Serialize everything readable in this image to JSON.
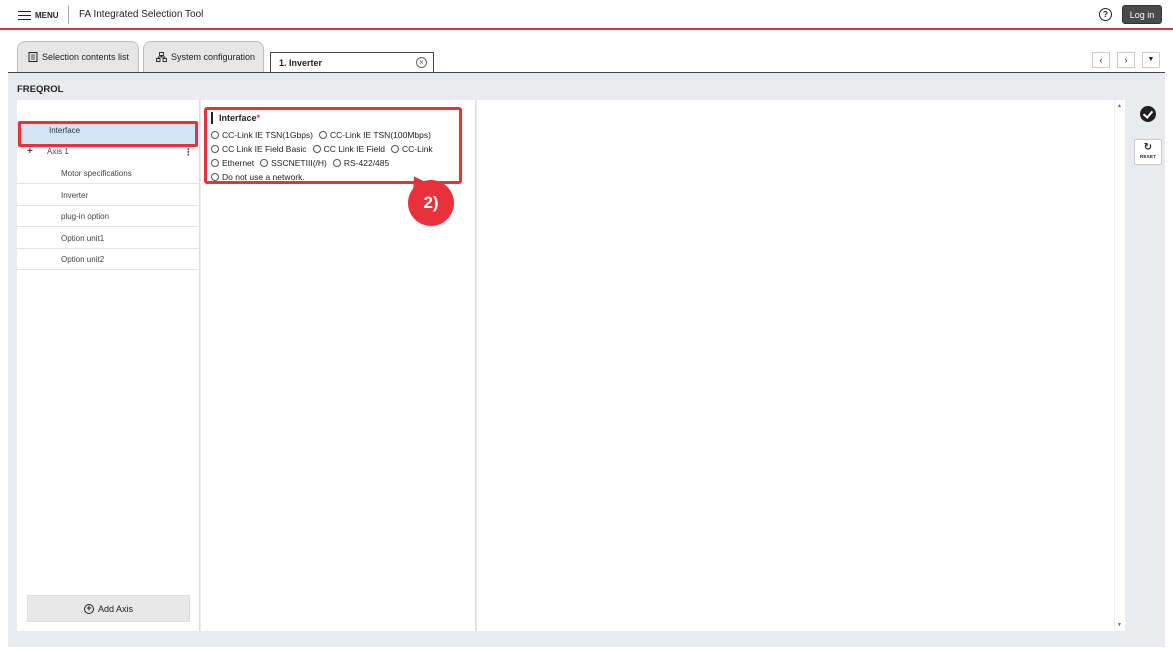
{
  "header": {
    "menu_label": "MENU",
    "app_title": "FA Integrated Selection Tool",
    "help_glyph": "?",
    "login_label": "Log in"
  },
  "tabs": {
    "selection_contents": "Selection contents list",
    "system_configuration": "System configuration",
    "active_tab": "1. Inverter",
    "close_glyph": "×",
    "prev_glyph": "‹",
    "next_glyph": "›",
    "menu_glyph": "▼"
  },
  "section": {
    "title": "FREQROL"
  },
  "tree": {
    "interface": "Interface",
    "axis": {
      "expand_glyph": "+",
      "label": "Axis 1",
      "more_glyph": "⋮"
    },
    "children": [
      "Motor specifications",
      "Inverter",
      "plug-in option",
      "Option unit1",
      "Option unit2"
    ],
    "add_axis_label": "Add Axis",
    "add_glyph": "+"
  },
  "interface_field": {
    "label": "Interface",
    "required_mark": "*",
    "options": [
      "CC-Link IE TSN(1Gbps)",
      "CC-Link IE TSN(100Mbps)",
      "CC Link IE Field Basic",
      "CC Link IE Field",
      "CC-Link",
      "Ethernet",
      "SSCNETIII(/H)",
      "RS-422/485",
      "Do not use a network."
    ],
    "selected": null
  },
  "tools": {
    "reset_glyph": "↻",
    "reset_label": "RESET"
  },
  "annotation": {
    "step_label": "2)"
  },
  "colors": {
    "accent_red": "#e8313b",
    "header_rule": "#d9363e",
    "selected_row": "#d4e4f7",
    "workspace_bg": "#e9ebee",
    "login_button": "#4a4a4a"
  }
}
